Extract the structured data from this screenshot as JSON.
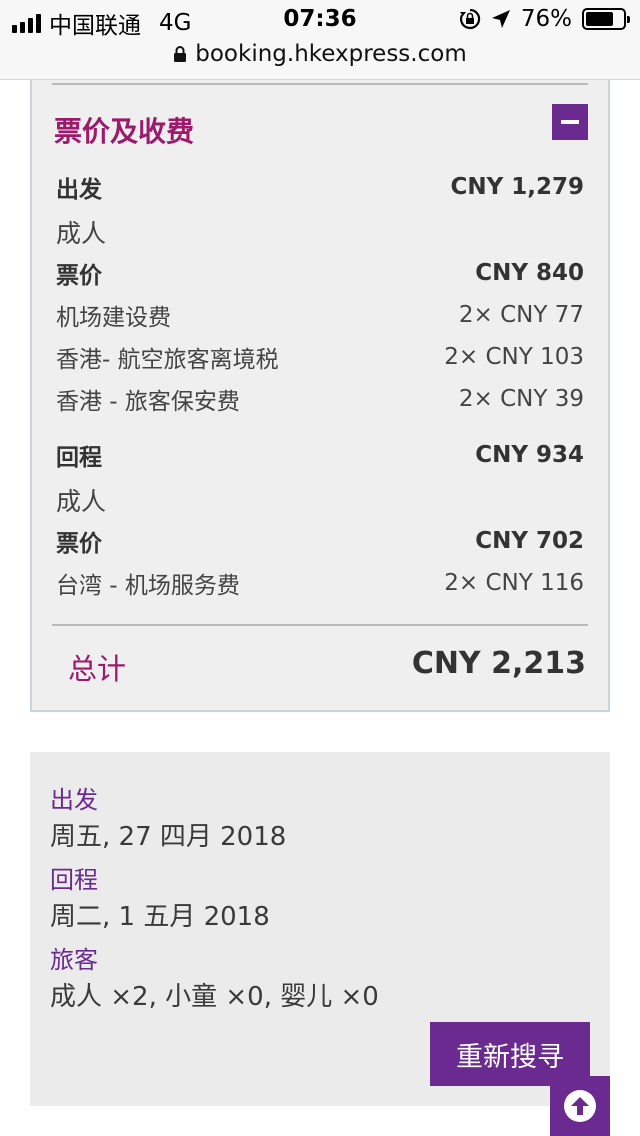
{
  "status_bar": {
    "carrier": "中国联通",
    "network": "4G",
    "time": "07:36",
    "battery": "76%",
    "battery_level": 0.76
  },
  "url_bar": {
    "url": "booking.hkexpress.com"
  },
  "price_breakdown": {
    "title": "票价及收费",
    "departure": {
      "label": "出发",
      "amount": "CNY 1,279",
      "passenger_type": "成人",
      "fare_label": "票价",
      "fare_amount": "CNY 840",
      "fees": [
        {
          "name": "机场建设费",
          "amount": "2× CNY 77"
        },
        {
          "name": "香港- 航空旅客离境税",
          "amount": "2× CNY 103"
        },
        {
          "name": "香港 - 旅客保安费",
          "amount": "2× CNY 39"
        }
      ]
    },
    "return": {
      "label": "回程",
      "amount": "CNY 934",
      "passenger_type": "成人",
      "fare_label": "票价",
      "fare_amount": "CNY 702",
      "fees": [
        {
          "name": "台湾 - 机场服务费",
          "amount": "2× CNY 116"
        }
      ]
    },
    "total_label": "总计",
    "total_amount": "CNY 2,213"
  },
  "trip_summary": {
    "departure_label": "出发",
    "departure_date": "周五, 27 四月 2018",
    "return_label": "回程",
    "return_date": "周二, 1 五月 2018",
    "passengers_label": "旅客",
    "passengers_value": "成人 ×2, 小童 ×0, 婴儿 ×0",
    "search_again_label": "重新搜寻"
  },
  "colors": {
    "accent_purple": "#6b2a8f",
    "title_magenta": "#9c1a6c"
  },
  "icons": [
    "signal-icon",
    "orientation-lock-icon",
    "location-arrow-icon",
    "battery-icon",
    "lock-icon",
    "minus-icon",
    "arrow-up-icon"
  ]
}
